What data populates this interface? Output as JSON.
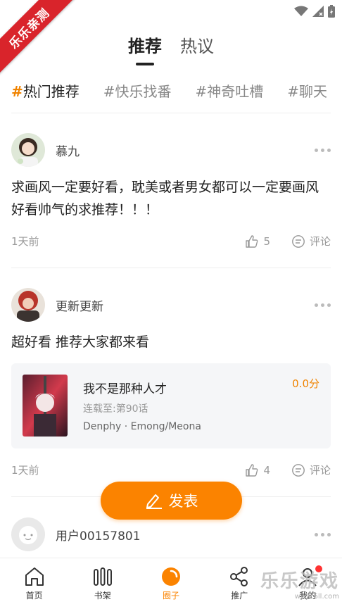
{
  "ribbon": {
    "text": "乐乐亲测"
  },
  "tabs": [
    {
      "label": "推荐",
      "active": true
    },
    {
      "label": "热议",
      "active": false
    }
  ],
  "topics": [
    {
      "label": "#热门推荐",
      "active": true
    },
    {
      "label": "#快乐找番",
      "active": false
    },
    {
      "label": "#神奇吐槽",
      "active": false
    },
    {
      "label": "#聊天",
      "active": false
    }
  ],
  "posts": [
    {
      "username": "慕九",
      "text": "求画风一定要好看，耽美或者男女都可以一定要画风好看帅气的求推荐！！！",
      "time": "1天前",
      "likes": "5",
      "comment_label": "评论"
    },
    {
      "username": "更新更新",
      "text": "超好看 推荐大家都来看",
      "time": "1天前",
      "likes": "4",
      "comment_label": "评论",
      "book": {
        "title": "我不是那种人才",
        "score": "0.0分",
        "status": "连载至:第90话",
        "author": "Denphy · Emong/Meona"
      }
    },
    {
      "username": "用户00157801"
    }
  ],
  "fab": {
    "label": "发表",
    "icon": "edit-icon"
  },
  "bottom_nav": [
    {
      "label": "首页",
      "icon": "home-icon",
      "active": false
    },
    {
      "label": "书架",
      "icon": "bookshelf-icon",
      "active": false
    },
    {
      "label": "圈子",
      "icon": "circle-icon",
      "active": true
    },
    {
      "label": "推广",
      "icon": "share-icon",
      "active": false
    },
    {
      "label": "我的",
      "icon": "profile-icon",
      "active": false
    }
  ],
  "watermark": {
    "text": "乐乐游戏",
    "url_text": "www.6ll.com"
  },
  "colors": {
    "accent": "#fb8300",
    "ribbon": "#d9242b"
  }
}
